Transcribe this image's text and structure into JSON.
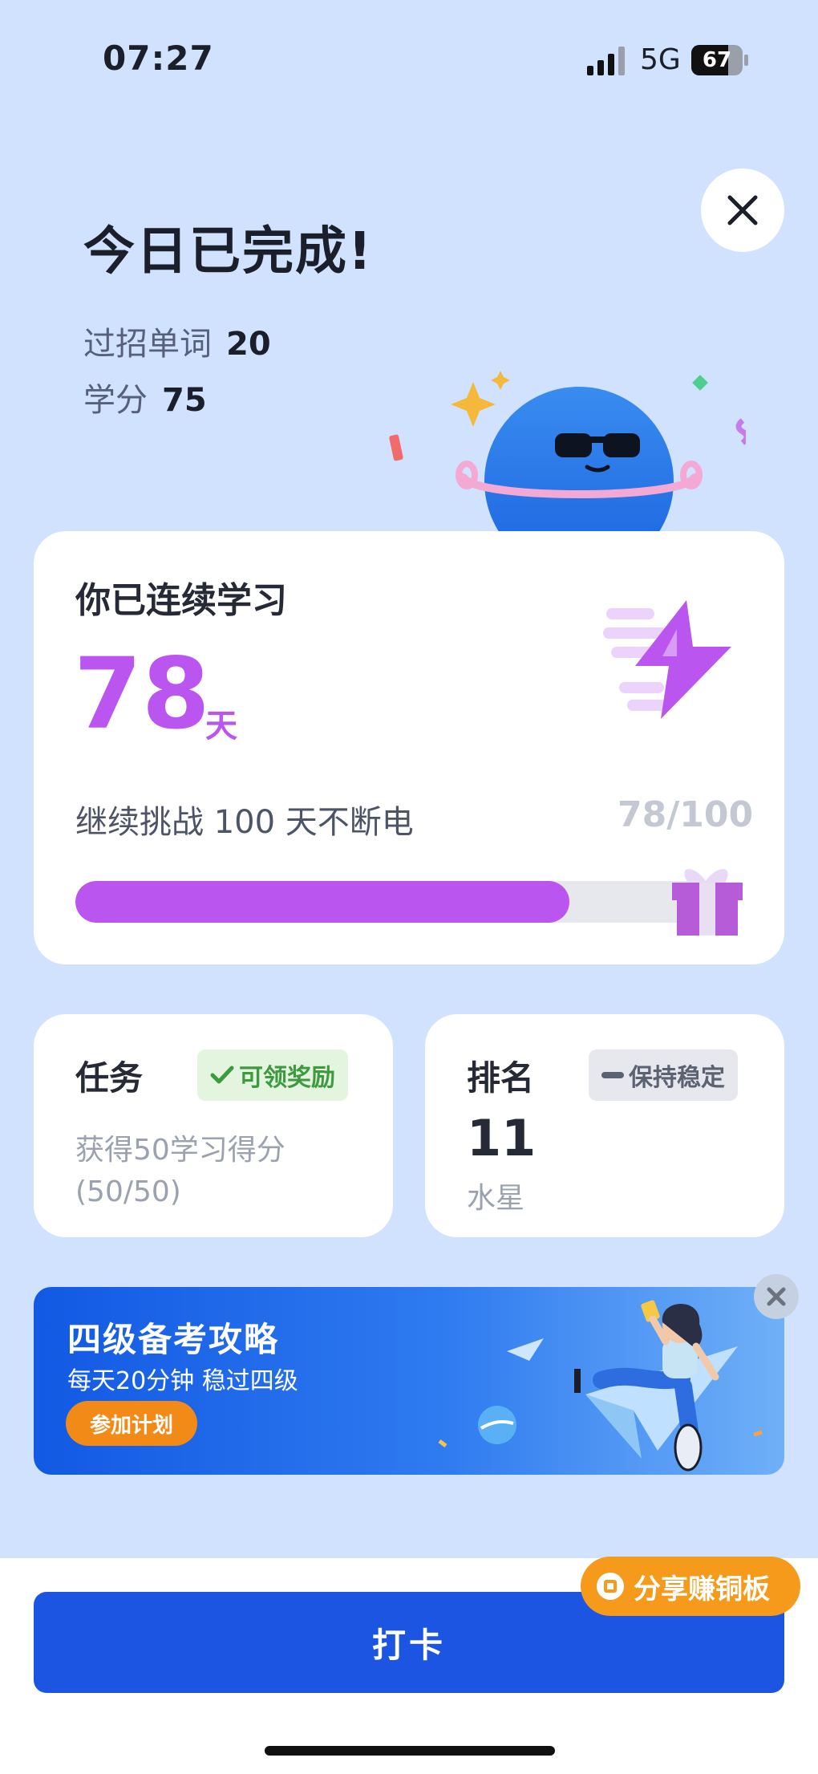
{
  "status_bar": {
    "time": "07:27",
    "network": "5G",
    "battery": "67"
  },
  "header": {
    "title": "今日已完成!",
    "stats": [
      {
        "label": "过招单词",
        "value": "20"
      },
      {
        "label": "学分",
        "value": "75"
      }
    ]
  },
  "streak": {
    "label": "你已连续学习",
    "days": "78",
    "unit": "天",
    "challenge": "继续挑战 100 天不断电",
    "ratio": "78/100",
    "progress": 0.78,
    "color": "#bb55ef"
  },
  "task_card": {
    "title": "任务",
    "badge": "可领奖励",
    "description_line1": "获得50学习得分",
    "description_line2": "(50/50)"
  },
  "rank_card": {
    "title": "排名",
    "badge": "保持稳定",
    "rank": "11",
    "planet": "水星"
  },
  "banner": {
    "title": "四级备考攻略",
    "subtitle": "每天20分钟 稳过四级",
    "button": "参加计划"
  },
  "share": {
    "label": "分享赚铜板"
  },
  "checkin": {
    "label": "打卡"
  },
  "colors": {
    "primary_button": "#1d55e3",
    "accent_purple": "#bb55ef",
    "share_orange": "#f59a1a",
    "background": "#d0e2fd"
  }
}
